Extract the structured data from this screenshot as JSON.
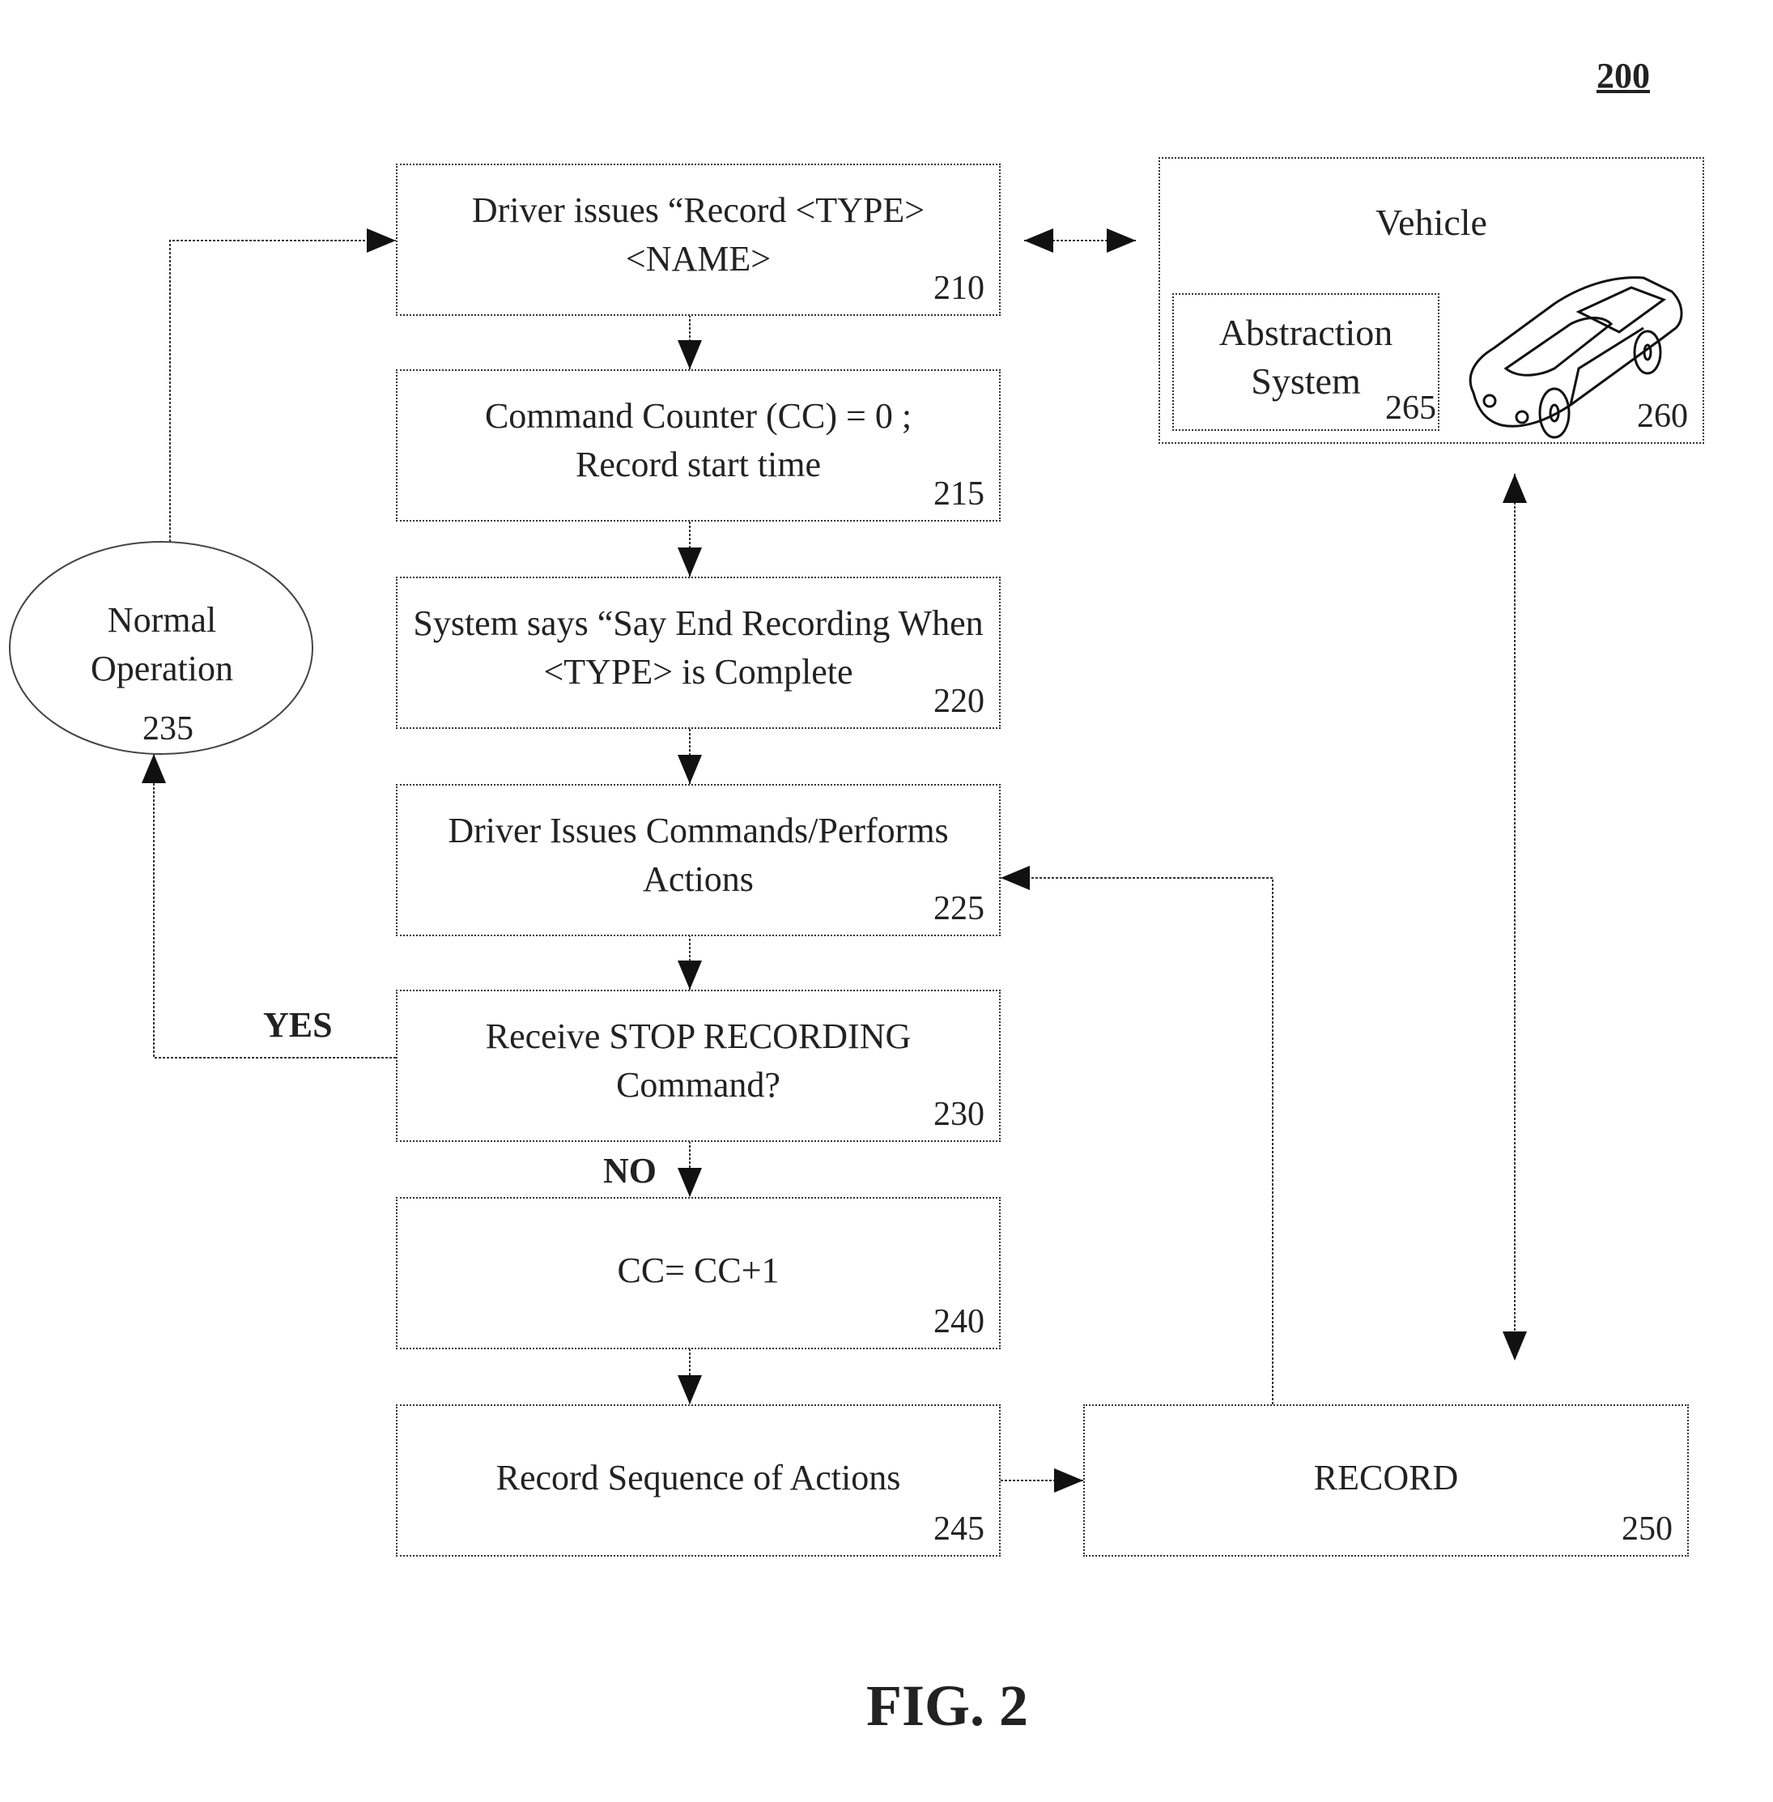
{
  "figure": {
    "number_label": "200",
    "caption": "FIG. 2"
  },
  "nodes": {
    "n210": {
      "text": "Driver issues “Record <TYPE> <NAME>",
      "ref": "210"
    },
    "n215": {
      "text": "Command Counter (CC) = 0 ; Record start time",
      "ref": "215"
    },
    "n220": {
      "text": "System says “Say End Recording When <TYPE> is Complete",
      "ref": "220"
    },
    "n225": {
      "text": "Driver Issues Commands/Performs Actions",
      "ref": "225"
    },
    "n230": {
      "text": "Receive STOP RECORDING Command?",
      "ref": "230"
    },
    "n235": {
      "text": "Normal Operation",
      "ref": "235"
    },
    "n240": {
      "text": "CC= CC+1",
      "ref": "240"
    },
    "n245": {
      "text": "Record Sequence of Actions",
      "ref": "245"
    },
    "n250": {
      "text": "RECORD",
      "ref": "250"
    },
    "n260": {
      "text": "Vehicle",
      "ref": "260"
    },
    "n265": {
      "text": "Abstraction System",
      "ref": "265"
    }
  },
  "edge_labels": {
    "yes": "YES",
    "no": "NO"
  },
  "icons": {
    "vehicle": "car-icon"
  }
}
